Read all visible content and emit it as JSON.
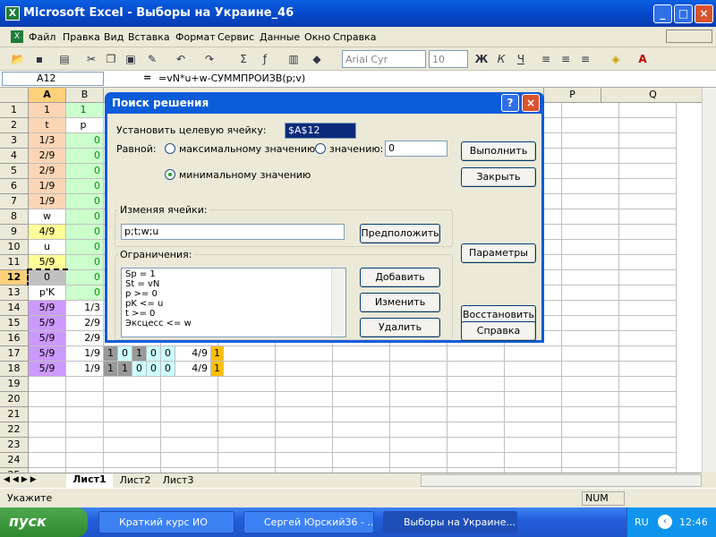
{
  "window": {
    "title": "Microsoft Excel - Выборы на Украине_46",
    "min": "_",
    "max": "□",
    "close": "×"
  },
  "menu": [
    "Файл",
    "Правка",
    "Вид",
    "Вставка",
    "Формат",
    "Сервис",
    "Данные",
    "Окно",
    "Справка"
  ],
  "toolbar": {
    "font": "Arial Cyr",
    "size": "10",
    "bold": "Ж",
    "italic": "К",
    "underline": "Ч"
  },
  "formula_bar": {
    "namebox": "A12",
    "eq": "=",
    "formula": "=vN*u+w-СУММПРОИЗВ(p;v)"
  },
  "columns": [
    "A",
    "B",
    "P",
    "Q"
  ],
  "row_numbers": [
    "1",
    "2",
    "3",
    "4",
    "5",
    "6",
    "7",
    "8",
    "9",
    "10",
    "11",
    "12",
    "13",
    "14",
    "15",
    "16",
    "17",
    "18",
    "19",
    "20",
    "21",
    "22",
    "23",
    "24",
    "25"
  ],
  "colA": [
    "1",
    "t",
    "1/3",
    "2/9",
    "2/9",
    "1/9",
    "1/9",
    "w",
    "4/9",
    "u",
    "5/9",
    "0",
    "p'K",
    "5/9",
    "5/9",
    "5/9",
    "5/9",
    "5/9"
  ],
  "colB": [
    "1",
    "p",
    "0",
    "0",
    "0",
    "0",
    "0",
    "0",
    "0",
    "0",
    "0",
    "0",
    "0",
    "1/3",
    "2/9",
    "2/9",
    "1/9",
    "1/9"
  ],
  "row17": [
    "1",
    "0",
    "1",
    "0",
    "0",
    "4/9",
    "1"
  ],
  "row18": [
    "1",
    "1",
    "0",
    "0",
    "0",
    "4/9",
    "1"
  ],
  "dialog": {
    "title": "Поиск решения",
    "help": "?",
    "close": "×",
    "target_label": "Установить целевую ячейку:",
    "target_value": "$A$12",
    "equal_label": "Равной:",
    "opt_max": "максимальному значению",
    "opt_value": "значению:",
    "value_field": "0",
    "opt_min": "минимальному значению",
    "changing_label": "Изменяя ячейки:",
    "changing_value": "p;t;w;u",
    "guess": "Предположить",
    "constraints_label": "Ограничения:",
    "constraints": [
      "Sp = 1",
      "St = vN",
      "p >= 0",
      "pK <= u",
      "t >= 0",
      "Эксцесс <= w"
    ],
    "add": "Добавить",
    "change": "Изменить",
    "delete": "Удалить",
    "solve": "Выполнить",
    "close_btn": "Закрыть",
    "options": "Параметры",
    "reset": "Восстановить",
    "help_btn": "Справка"
  },
  "sheets": [
    "Лист1",
    "Лист2",
    "Лист3"
  ],
  "status": {
    "left": "Укажите",
    "num": "NUM"
  },
  "taskbar": {
    "start": "пуск",
    "items": [
      "Краткий курс ИО",
      "Сергей Юрский36 - ...",
      "Выборы на Украине..."
    ],
    "lang": "RU",
    "clock": "12:46"
  }
}
